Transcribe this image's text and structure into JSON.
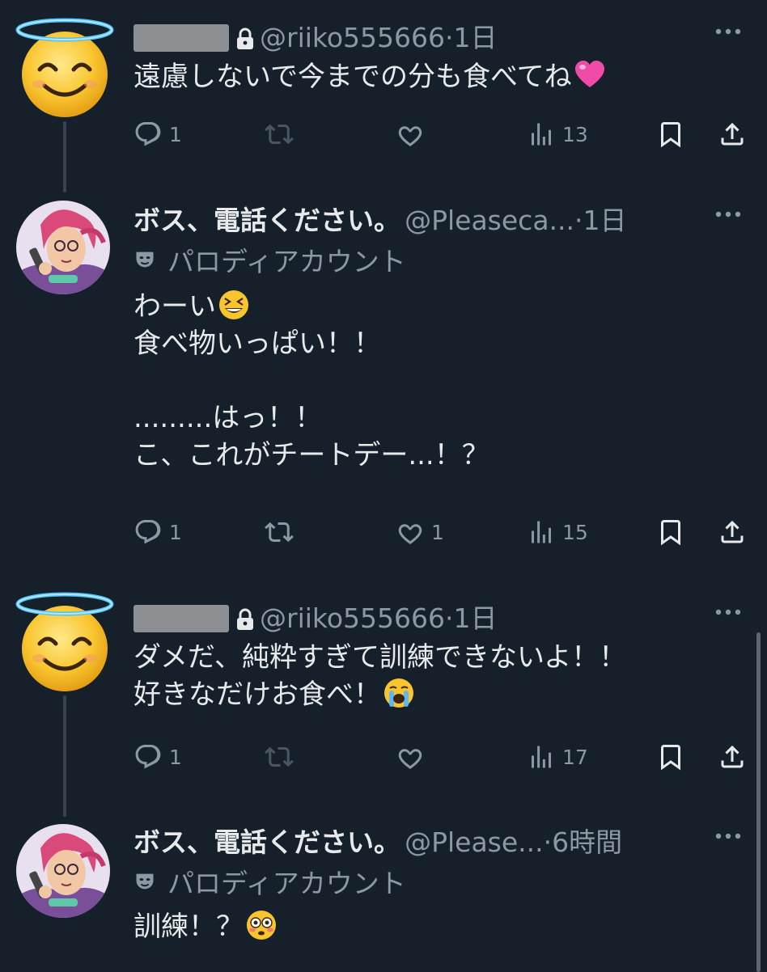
{
  "tweets": [
    {
      "handle": "@riiko555666",
      "time": "1日",
      "text": "遠慮しないで今までの分も食べてね",
      "stats": {
        "reply": "1",
        "retweet": "",
        "like": "",
        "views": "13"
      }
    },
    {
      "name": "ボス、電話ください。",
      "handle": "@Pleaseca...",
      "time": "1日",
      "badge": "パロディアカウント",
      "line1": "わーい",
      "text_rest": "食べ物いっぱい！！\n\n.........はっ！！\nこ、これがチートデー...！？",
      "stats": {
        "reply": "1",
        "retweet": "",
        "like": "1",
        "views": "15"
      }
    },
    {
      "handle": "@riiko555666",
      "time": "1日",
      "line1": "ダメだ、純粋すぎて訓練できないよ！！",
      "line2": "好きなだけお食べ！",
      "stats": {
        "reply": "1",
        "retweet": "",
        "like": "",
        "views": "17"
      }
    },
    {
      "name": "ボス、電話ください。",
      "handle": "@Please...",
      "time": "6時間",
      "badge": "パロディアカウント",
      "text": "訓練！？"
    }
  ],
  "colors": {
    "bg": "#15202b",
    "muted": "#8b98a5",
    "text": "#e7e9ea"
  },
  "icons": [
    "halo-smiling-face-icon",
    "lock-icon",
    "more-icon",
    "reply-icon",
    "retweet-icon",
    "like-icon",
    "views-icon",
    "bookmark-icon",
    "share-icon",
    "mask-icon",
    "heart-emoji",
    "grinning-squinting-emoji",
    "crying-emoji",
    "flushed-emoji"
  ]
}
